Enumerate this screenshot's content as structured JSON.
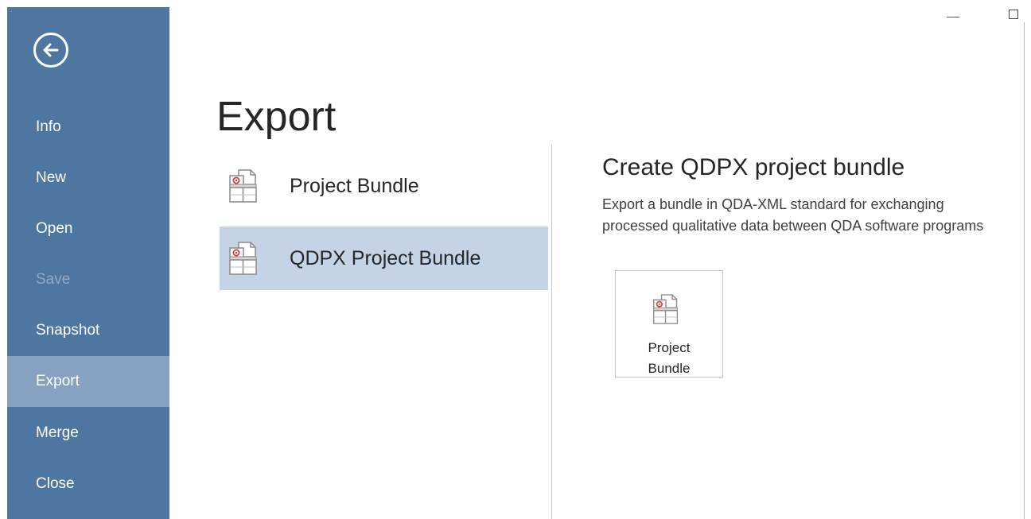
{
  "sidebar": {
    "back_icon": "arrow-left-circle-icon",
    "items": [
      {
        "label": "Info"
      },
      {
        "label": "New"
      },
      {
        "label": "Open"
      },
      {
        "label": "Save"
      },
      {
        "label": "Snapshot"
      },
      {
        "label": "Export"
      },
      {
        "label": "Merge"
      },
      {
        "label": "Close"
      }
    ],
    "active_item": "Export",
    "disabled_item": "Save",
    "colors": {
      "background": "#4d76a0",
      "active": "#87a2c0",
      "text": "#ffffff",
      "disabled_text": "#8fa9c6"
    }
  },
  "window_controls": {
    "minimize_icon": "minimize-icon",
    "maximize_icon": "maximize-icon"
  },
  "main": {
    "title": "Export",
    "export_types": [
      {
        "label": "Project Bundle",
        "icon": "project-bundle-icon"
      },
      {
        "label": "QDPX Project Bundle",
        "icon": "project-bundle-icon"
      }
    ],
    "selected_export_type": "QDPX Project Bundle",
    "detail": {
      "title": "Create QDPX project bundle",
      "description": "Export a bundle in QDA-XML standard for exchanging processed qualitative data between QDA software programs",
      "button": {
        "line1": "Project",
        "line2": "Bundle",
        "icon": "project-bundle-icon"
      }
    },
    "colors": {
      "selection": "#c4d3e5"
    }
  }
}
